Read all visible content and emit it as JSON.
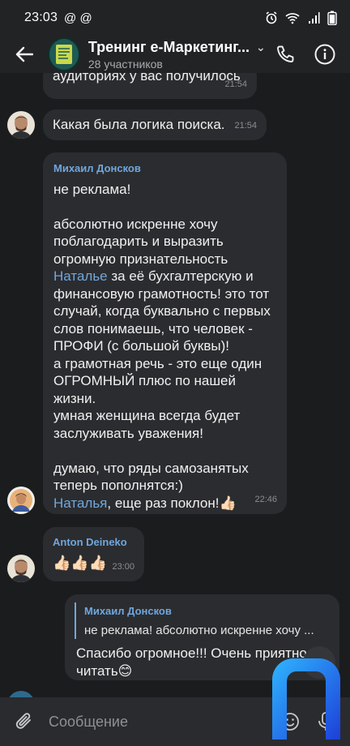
{
  "status": {
    "time": "23:03",
    "notifications": "@ @",
    "battery_icon": "battery-icon",
    "wifi_icon": "wifi-icon",
    "alarm_icon": "alarm-icon"
  },
  "header": {
    "title": "Тренинг е-Маркетинг...",
    "subtitle": "28 участников"
  },
  "messages": [
    {
      "text": "аудиториях у вас получилось",
      "time": "21:54"
    },
    {
      "text": "Какая была логика поиска.",
      "time": "21:54"
    },
    {
      "sender": "Михаил Донсков",
      "p1": "не реклама!",
      "p2": "абсолютно искренне хочу поблагодарить и выразить огромную признательность",
      "mention1": "Наталье",
      "p3": " за её бухгалтерскую и финансовую грамотность! это тот случай, когда буквально с первых слов понимаешь, что человек - ПРОФИ (с большой буквы)!\nа грамотная речь - это еще один ОГРОМНЫЙ плюс по нашей жизни.\nумная женщина всегда будет заслуживать уважения!",
      "p4": "думаю, что ряды самозанятых теперь пополнятся:)",
      "mention2": "Наталья",
      "p5": ", еще раз поклон!👍🏻",
      "time": "22:46"
    },
    {
      "sender": "Anton Deineko",
      "text": "👍🏻👍🏻👍🏻",
      "time": "23:00"
    },
    {
      "reply_author": "Михаил Донсков",
      "reply_text": "не реклама!  абсолютно искренне хочу ...",
      "text": "Спасибо огромное!!! Очень приятно читать😊"
    }
  ],
  "input": {
    "placeholder": "Сообщение"
  },
  "colors": {
    "accent": "#6fa7dd",
    "bubble": "#2b2c2f",
    "background": "#1b1c1e"
  }
}
